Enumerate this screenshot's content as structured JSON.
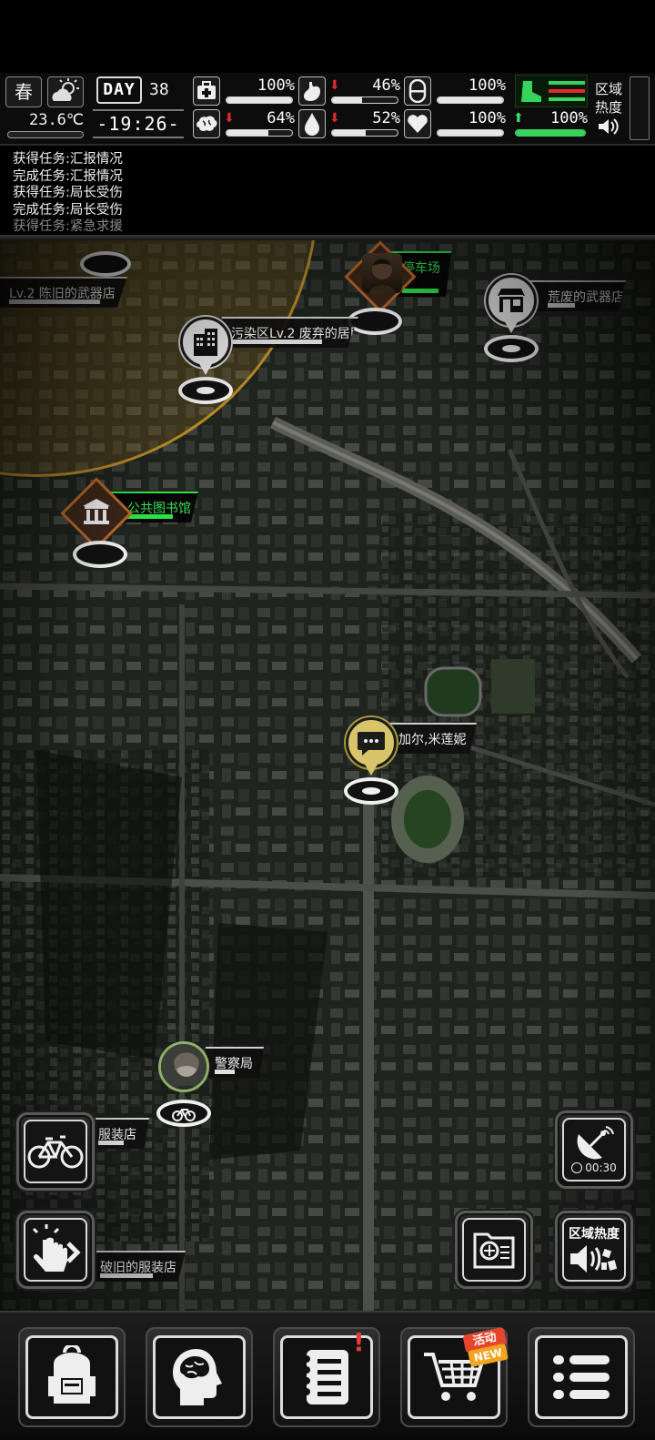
{
  "status": {
    "season": "春",
    "weather_icon": "partly-cloudy-icon",
    "temperature": "23.6℃",
    "day_label": "DAY",
    "day_number": "38",
    "time": "-19:26-",
    "stats": [
      {
        "icon": "health-kit-icon",
        "value": "100%",
        "trend": "",
        "fill": 1.0
      },
      {
        "icon": "stomach-icon",
        "value": "46%",
        "trend": "down",
        "fill": 0.46
      },
      {
        "icon": "pill-icon",
        "value": "100%",
        "trend": "",
        "fill": 1.0
      },
      {
        "icon": "brain-icon",
        "value": "64%",
        "trend": "down",
        "fill": 0.64
      },
      {
        "icon": "water-drop-icon",
        "value": "52%",
        "trend": "down",
        "fill": 0.52
      },
      {
        "icon": "heart-icon",
        "value": "100%",
        "trend": "",
        "fill": 1.0
      },
      {
        "icon": "boot-icon",
        "value": "100%",
        "trend": "up",
        "fill": 1.0
      }
    ],
    "zone_heat_label": "区域\n热度",
    "accent_green": "#37d35c",
    "alert_red": "#e12b2b"
  },
  "task_log": [
    "获得任务:汇报情况",
    "完成任务:汇报情况",
    "获得任务:局长受伤",
    "完成任务:局长受伤",
    "获得任务:紧急求援"
  ],
  "map": {
    "locations": {
      "old_weapon_shop": "Lv.2  陈旧的武器店",
      "parking_lot": "停车场",
      "abandoned_weapon_shop": "荒废的武器店",
      "abandoned_residence": "污染区Lv.2  废弃的居民楼",
      "library": "公共图书馆",
      "npc_chat": "加尔,米莲妮",
      "police_station": "警察局",
      "clothing_store": "服装店",
      "old_clothing_store": "破旧的服装店"
    },
    "radio_timer": "00:30",
    "zone_heat_button": "区域热度"
  },
  "bottom_nav": {
    "activity_badge_top": "活动",
    "activity_badge_bottom": "NEW",
    "quest_alert": "!"
  }
}
